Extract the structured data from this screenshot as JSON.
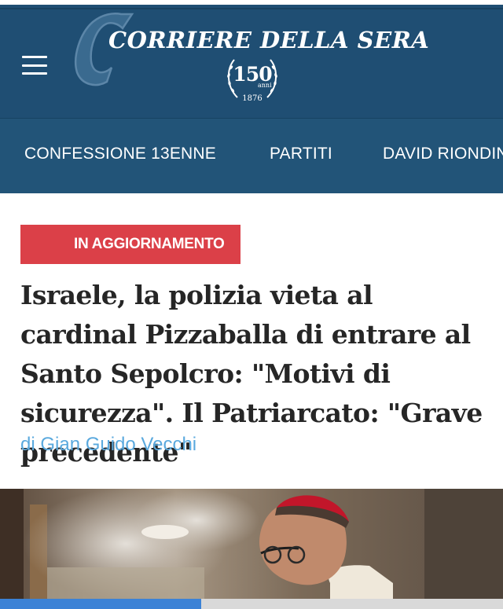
{
  "header": {
    "brand": "CORRIERE DELLA SERA",
    "seal_number": "150",
    "seal_anni": "anni",
    "seal_year": "1876",
    "background_color": "#1f4e73"
  },
  "topics": [
    {
      "label": "CONFESSIONE 13ENNE"
    },
    {
      "label": "PARTITI"
    },
    {
      "label": "DAVID RIONDINO"
    }
  ],
  "article": {
    "badge": "IN AGGIORNAMENTO",
    "badge_color": "#db4048",
    "headline": "Israele, la polizia vieta al cardinal Pizzaballa di entrare al Santo Sepolcro: \"Motivi di sicurezza\". Il Patriarcato: \"Grave precedente\"",
    "byline": "di Gian Guido Vecchi",
    "byline_color": "#5aa9de"
  },
  "progress": {
    "fraction": 0.4,
    "color": "#3b82d6"
  }
}
